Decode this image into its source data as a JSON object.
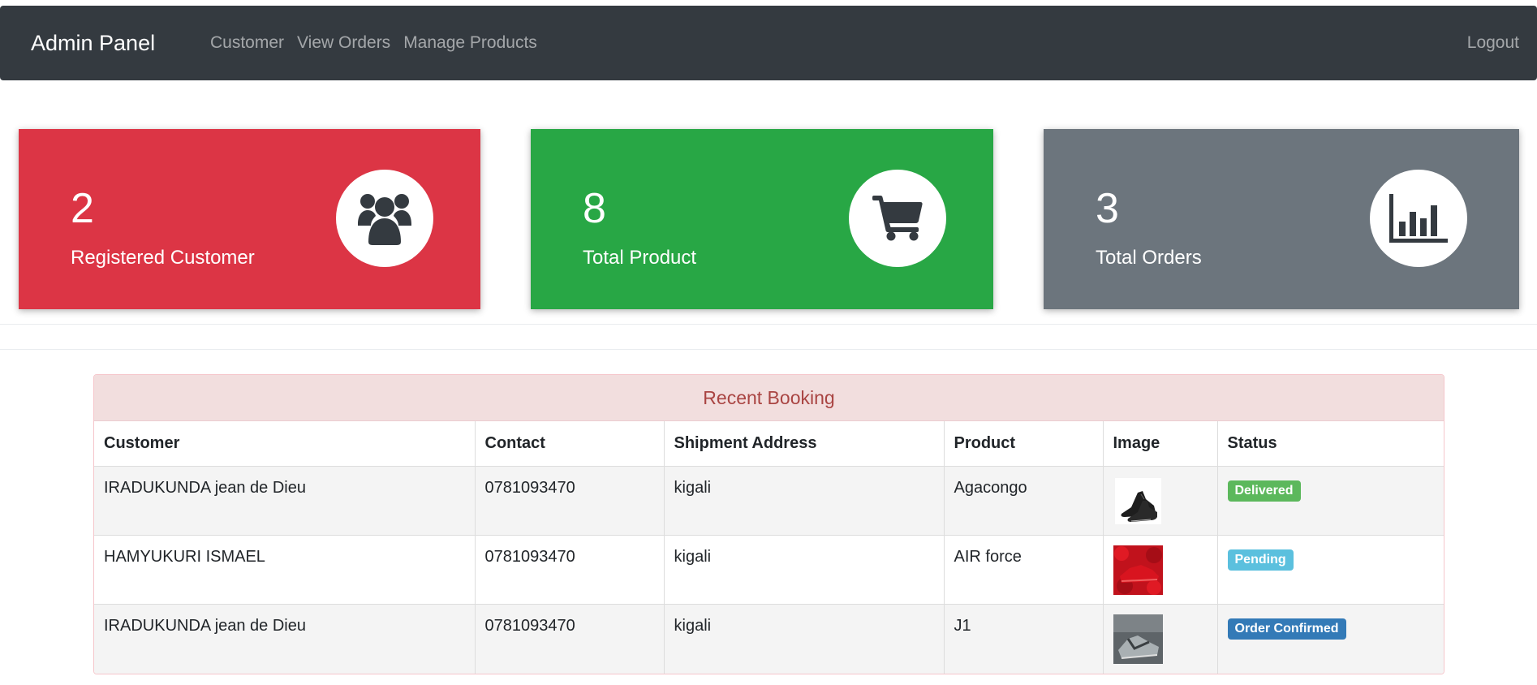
{
  "navbar": {
    "brand": "Admin Panel",
    "links": [
      "Customer",
      "View Orders",
      "Manage Products"
    ],
    "logout": "Logout",
    "background": "#343a40"
  },
  "stats": [
    {
      "count": "2",
      "label": "Registered Customer",
      "icon": "users-icon",
      "color": "#dc3545"
    },
    {
      "count": "8",
      "label": "Total Product",
      "icon": "shopping-cart-icon",
      "color": "#28a745"
    },
    {
      "count": "3",
      "label": "Total Orders",
      "icon": "bar-chart-icon",
      "color": "#6c757d"
    }
  ],
  "booking": {
    "title": "Recent Booking",
    "columns": [
      "Customer",
      "Contact",
      "Shipment Address",
      "Product",
      "Image",
      "Status"
    ],
    "rows": [
      {
        "customer": "IRADUKUNDA jean de Dieu",
        "contact": "0781093470",
        "address": "kigali",
        "product": "Agacongo",
        "image": "black-shoe-image",
        "status": "Delivered",
        "status_color": "#5cb85c"
      },
      {
        "customer": "HAMYUKURI ISMAEL",
        "contact": "0781093470",
        "address": "kigali",
        "product": "AIR force",
        "image": "red-shoe-image",
        "status": "Pending",
        "status_color": "#5bc0de"
      },
      {
        "customer": "IRADUKUNDA jean de Dieu",
        "contact": "0781093470",
        "address": "kigali",
        "product": "J1",
        "image": "gray-shoe-image",
        "status": "Order Confirmed",
        "status_color": "#337ab7"
      }
    ]
  }
}
